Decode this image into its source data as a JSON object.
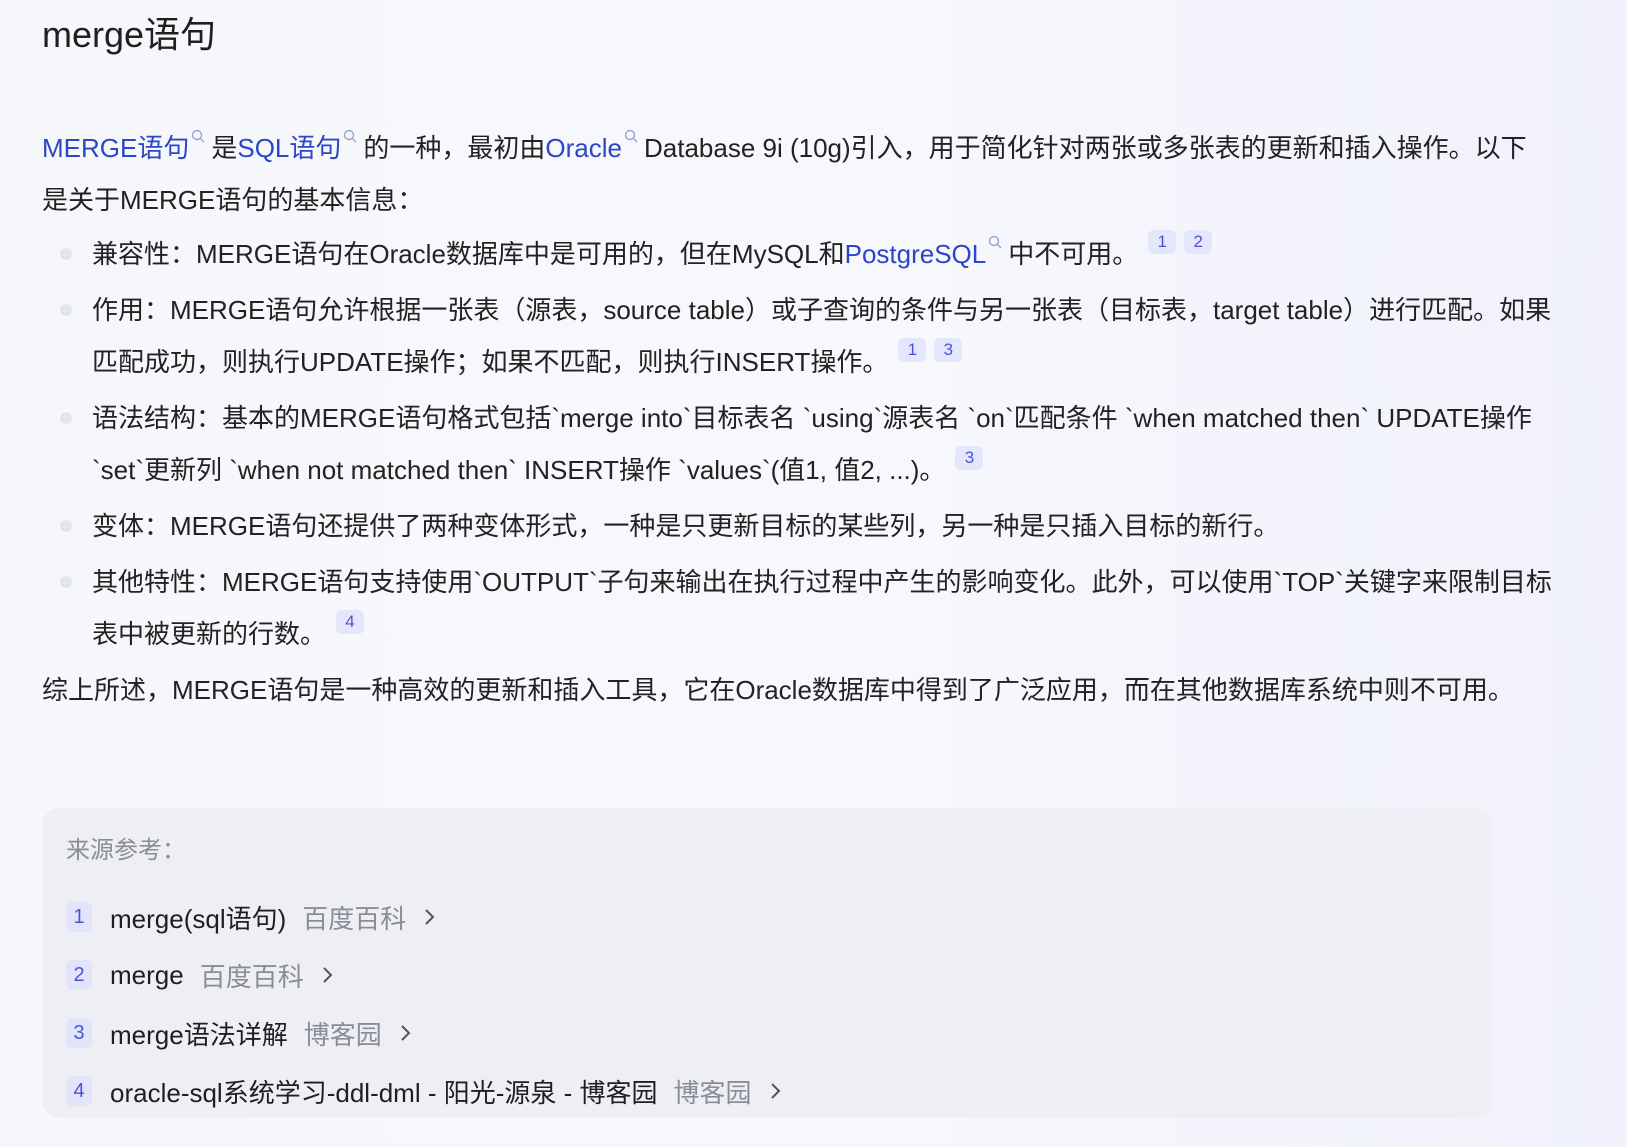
{
  "title": "merge语句",
  "intro": {
    "link1": "MERGE语句",
    "t1": "是",
    "link2": "SQL语句",
    "t2": "的一种，最初由",
    "link3": "Oracle",
    "t3": "Database 9i (10g)引入，用于简化针对两张或多张表的更新和插入操作。以下是关于MERGE语句的基本信息："
  },
  "bullets": [
    {
      "pre": "兼容性：MERGE语句在Oracle数据库中是可用的，但在MySQL和",
      "link": "PostgreSQL",
      "post": "中不可用。",
      "cites": [
        "1",
        "2"
      ]
    },
    {
      "text": "作用：MERGE语句允许根据一张表（源表，source table）或子查询的条件与另一张表（目标表，target table）进行匹配。如果匹配成功，则执行UPDATE操作；如果不匹配，则执行INSERT操作。",
      "cites": [
        "1",
        "3"
      ]
    },
    {
      "text": "语法结构：基本的MERGE语句格式包括`merge into`目标表名 `using`源表名 `on`匹配条件 `when matched then` UPDATE操作 `set`更新列 `when not matched then` INSERT操作 `values`(值1, 值2, ...)。",
      "cites": [
        "3"
      ]
    },
    {
      "text": "变体：MERGE语句还提供了两种变体形式，一种是只更新目标的某些列，另一种是只插入目标的新行。",
      "cites": []
    },
    {
      "text": "其他特性：MERGE语句支持使用`OUTPUT`子句来输出在执行过程中产生的影响变化。此外，可以使用`TOP`关键字来限制目标表中被更新的行数。",
      "cites": [
        "4"
      ]
    }
  ],
  "summary": "综上所述，MERGE语句是一种高效的更新和插入工具，它在Oracle数据库中得到了广泛应用，而在其他数据库系统中则不可用。",
  "sources": {
    "heading": "来源参考：",
    "items": [
      {
        "num": "1",
        "title": "merge(sql语句)",
        "site": "百度百科"
      },
      {
        "num": "2",
        "title": "merge",
        "site": "百度百科"
      },
      {
        "num": "3",
        "title": "merge语法详解",
        "site": "博客园"
      },
      {
        "num": "4",
        "title": "oracle-sql系统学习-ddl-dml - 阳光-源泉 - 博客园",
        "site": "博客园"
      }
    ]
  },
  "colors": {
    "link": "#2b46c9",
    "cite_bg": "#e4e7fb",
    "cite_fg": "#4a55d6",
    "muted": "#8a8d96"
  }
}
